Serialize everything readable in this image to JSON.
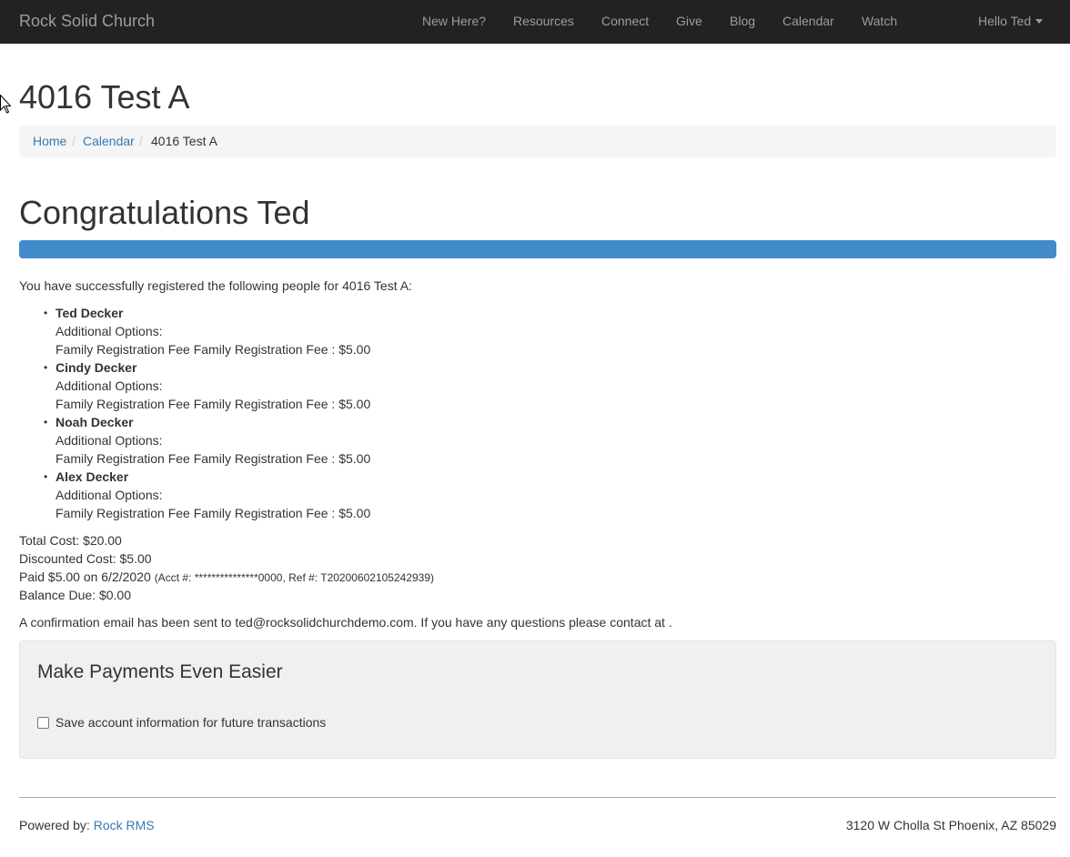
{
  "nav": {
    "brand": "Rock Solid Church",
    "links": [
      "New Here?",
      "Resources",
      "Connect",
      "Give",
      "Blog",
      "Calendar",
      "Watch"
    ],
    "user_menu": "Hello Ted"
  },
  "page": {
    "title": "4016 Test A"
  },
  "breadcrumb": {
    "items": [
      "Home",
      "Calendar",
      "4016 Test A"
    ],
    "separator": "/"
  },
  "main": {
    "heading": "Congratulations Ted",
    "progress_percent": 100,
    "intro": "You have successfully registered the following people for 4016 Test A:",
    "registrants": [
      {
        "name": "Ted Decker",
        "options_label": "Additional Options:",
        "fee": "Family Registration Fee Family Registration Fee : $5.00"
      },
      {
        "name": "Cindy Decker",
        "options_label": "Additional Options:",
        "fee": "Family Registration Fee Family Registration Fee : $5.00"
      },
      {
        "name": "Noah Decker",
        "options_label": "Additional Options:",
        "fee": "Family Registration Fee Family Registration Fee : $5.00"
      },
      {
        "name": "Alex Decker",
        "options_label": "Additional Options:",
        "fee": "Family Registration Fee Family Registration Fee : $5.00"
      }
    ],
    "total_cost": "Total Cost: $20.00",
    "discounted_cost": "Discounted Cost: $5.00",
    "paid": "Paid $5.00 on 6/2/2020",
    "paid_details": "(Acct #: ***************0000, Ref #: T20200602105242939)",
    "balance_due": "Balance Due: $0.00",
    "confirmation": "A confirmation email has been sent to ted@rocksolidchurchdemo.com. If you have any questions please contact at ."
  },
  "payments": {
    "title": "Make Payments Even Easier",
    "checkbox_label": "Save account information for future transactions",
    "checked": false
  },
  "footer": {
    "powered_by": "Powered by: ",
    "link": "Rock RMS",
    "address": "3120 W Cholla St Phoenix, AZ 85029"
  },
  "colors": {
    "navbar": "#222222",
    "nav_text": "#9d9d9d",
    "link": "#337ab7",
    "progress": "#428bca"
  }
}
